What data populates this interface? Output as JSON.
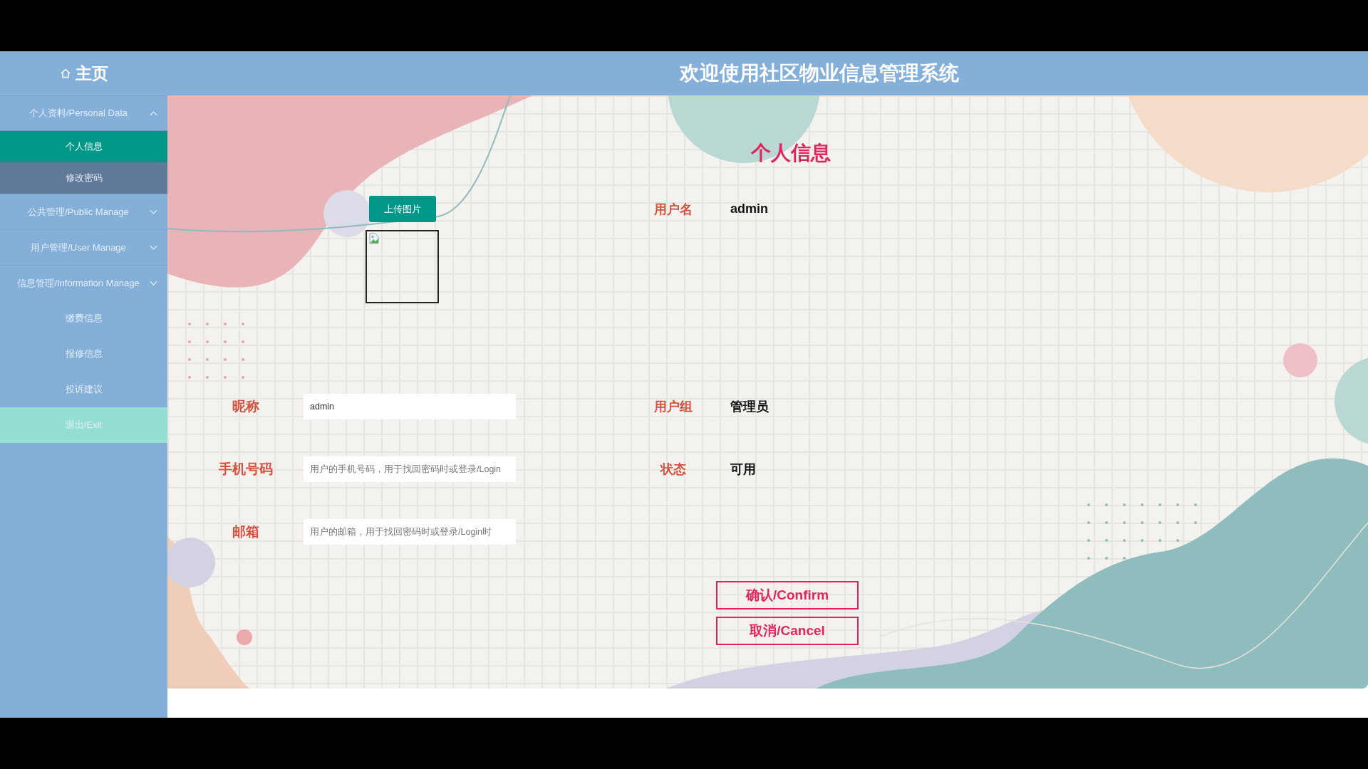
{
  "header": {
    "home_label": "主页",
    "title": "欢迎使用社区物业信息管理系统"
  },
  "sidebar": {
    "items": [
      {
        "kind": "group",
        "label": "个人资料/Personal Data",
        "expanded": true,
        "children": [
          {
            "label": "个人信息",
            "selected": true
          },
          {
            "label": "修改密码",
            "selected": false
          }
        ]
      },
      {
        "kind": "group",
        "label": "公共管理/Public Manage",
        "expanded": false
      },
      {
        "kind": "group",
        "label": "用户管理/User Manage",
        "expanded": false
      },
      {
        "kind": "group",
        "label": "信息管理/Information Manage",
        "expanded": false
      },
      {
        "kind": "link",
        "label": "缴费信息"
      },
      {
        "kind": "link",
        "label": "报修信息"
      },
      {
        "kind": "link",
        "label": "投诉建议"
      },
      {
        "kind": "exit",
        "label": "退出/Exit"
      }
    ]
  },
  "profile": {
    "title": "个人信息",
    "upload_button": "上传图片",
    "username": {
      "label": "用户名",
      "value": "admin"
    },
    "rows": [
      {
        "input": {
          "label": "昵称",
          "value": "admin"
        },
        "detail": {
          "label": "用户组",
          "value": "管理员"
        }
      },
      {
        "input": {
          "label": "手机号码",
          "placeholder": "用户的手机号码，用于找回密码时或登录/Login"
        },
        "detail": {
          "label": "状态",
          "value": "可用"
        }
      },
      {
        "input": {
          "label": "邮箱",
          "placeholder": "用户的邮箱，用于找回密码时或登录/Login时"
        }
      }
    ],
    "buttons": [
      "确认/Confirm",
      "取消/Cancel"
    ]
  }
}
